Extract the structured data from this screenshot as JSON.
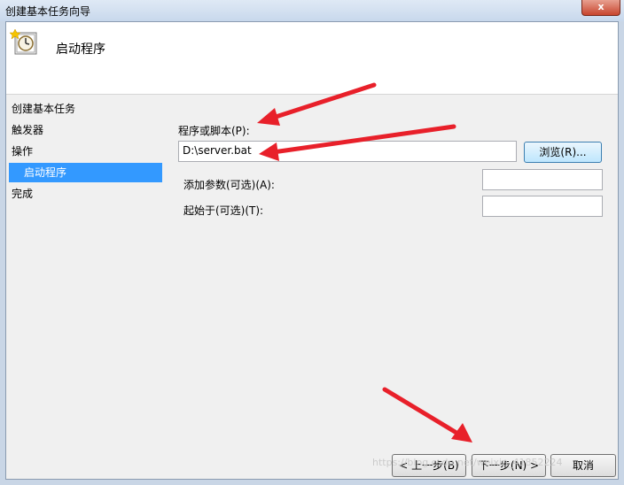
{
  "window": {
    "title": "创建基本任务向导",
    "close_label": "x"
  },
  "header": {
    "title": "启动程序",
    "icon": "clock-task-icon"
  },
  "nav": {
    "items": [
      {
        "label": "创建基本任务"
      },
      {
        "label": "触发器"
      },
      {
        "label": "操作"
      },
      {
        "label": "启动程序"
      },
      {
        "label": "完成"
      }
    ]
  },
  "form": {
    "program_label": "程序或脚本(P):",
    "program_value": "D:\\server.bat",
    "browse_label": "浏览(R)...",
    "args_label": "添加参数(可选)(A):",
    "args_value": "",
    "startin_label": "起始于(可选)(T):",
    "startin_value": ""
  },
  "buttons": {
    "back": "< 上一步(B)",
    "next": "下一步(N) >",
    "cancel": "取消"
  },
  "watermark": "https://blog.csdn.net/weixin_41852224",
  "colors": {
    "selected_nav": "#3399ff",
    "annotation_arrow": "#e8202a"
  }
}
